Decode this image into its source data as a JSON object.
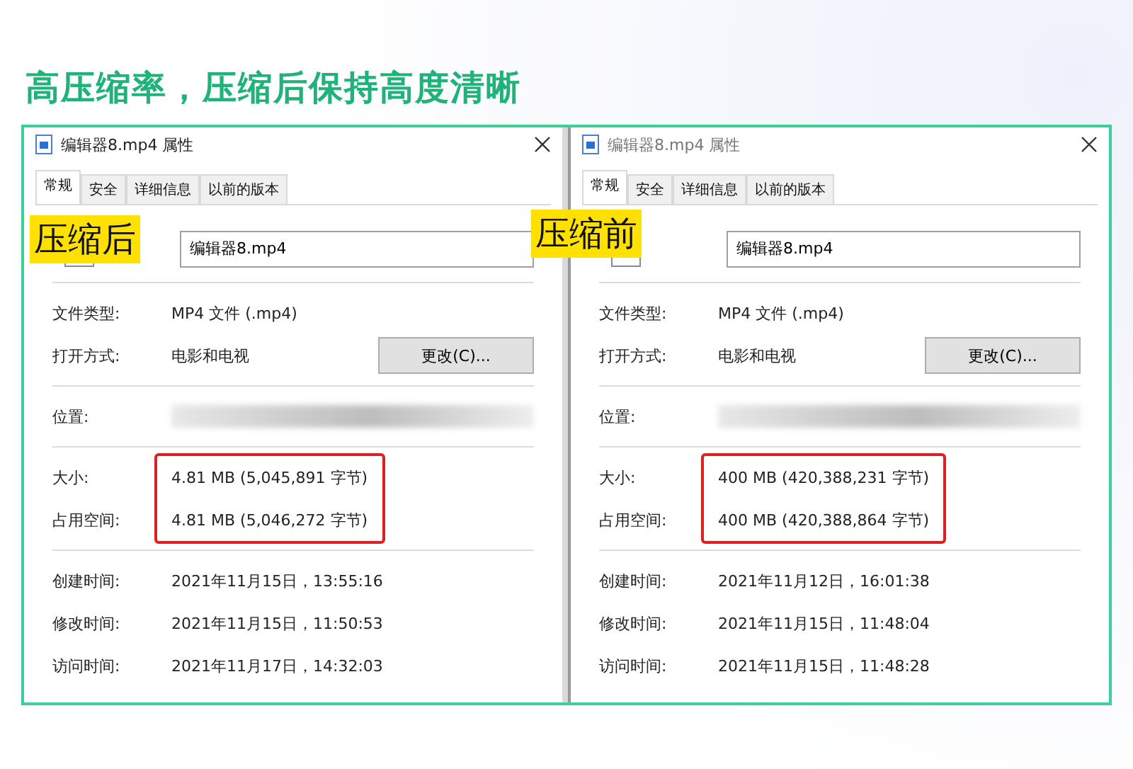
{
  "headline": "高压缩率，压缩后保持高度清晰",
  "panels": [
    {
      "badge": "压缩后",
      "title": "编辑器8.mp4 属性",
      "tabs": [
        {
          "label": "常规",
          "selected": true
        },
        {
          "label": "安全",
          "selected": false
        },
        {
          "label": "详细信息",
          "selected": false
        },
        {
          "label": "以前的版本",
          "selected": false
        }
      ],
      "file_name": "编辑器8.mp4",
      "sections": [
        {
          "highlighted": false,
          "rows": [
            {
              "kind": "text",
              "label": "文件类型:",
              "value": "MP4 文件 (.mp4)"
            },
            {
              "kind": "button",
              "label": "打开方式:",
              "value": "电影和电视",
              "button": "更改(C)..."
            }
          ]
        },
        {
          "highlighted": false,
          "rows": [
            {
              "kind": "blurred",
              "label": "位置:"
            }
          ]
        },
        {
          "highlighted": true,
          "rows": [
            {
              "kind": "text",
              "label": "大小:",
              "value": "4.81 MB (5,045,891 字节)"
            },
            {
              "kind": "text",
              "label": "占用空间:",
              "value": "4.81 MB (5,046,272 字节)"
            }
          ]
        },
        {
          "highlighted": false,
          "rows": [
            {
              "kind": "text",
              "label": "创建时间:",
              "value": "2021年11月15日，13:55:16"
            },
            {
              "kind": "text",
              "label": "修改时间:",
              "value": "2021年11月15日，11:50:53"
            },
            {
              "kind": "text",
              "label": "访问时间:",
              "value": "2021年11月17日，14:32:03"
            }
          ]
        }
      ]
    },
    {
      "badge": "压缩前",
      "title": "编辑器8.mp4 属性",
      "tabs": [
        {
          "label": "常规",
          "selected": true
        },
        {
          "label": "安全",
          "selected": false
        },
        {
          "label": "详细信息",
          "selected": false
        },
        {
          "label": "以前的版本",
          "selected": false
        }
      ],
      "file_name": "编辑器8.mp4",
      "sections": [
        {
          "highlighted": false,
          "rows": [
            {
              "kind": "text",
              "label": "文件类型:",
              "value": "MP4 文件 (.mp4)"
            },
            {
              "kind": "button",
              "label": "打开方式:",
              "value": "电影和电视",
              "button": "更改(C)..."
            }
          ]
        },
        {
          "highlighted": false,
          "rows": [
            {
              "kind": "blurred",
              "label": "位置:"
            }
          ]
        },
        {
          "highlighted": true,
          "rows": [
            {
              "kind": "text",
              "label": "大小:",
              "value": "400 MB (420,388,231 字节)"
            },
            {
              "kind": "text",
              "label": "占用空间:",
              "value": "400 MB (420,388,864 字节)"
            }
          ]
        },
        {
          "highlighted": false,
          "rows": [
            {
              "kind": "text",
              "label": "创建时间:",
              "value": "2021年11月12日，16:01:38"
            },
            {
              "kind": "text",
              "label": "修改时间:",
              "value": "2021年11月15日，11:48:04"
            },
            {
              "kind": "text",
              "label": "访问时间:",
              "value": "2021年11月15日，11:48:28"
            }
          ]
        }
      ]
    }
  ]
}
